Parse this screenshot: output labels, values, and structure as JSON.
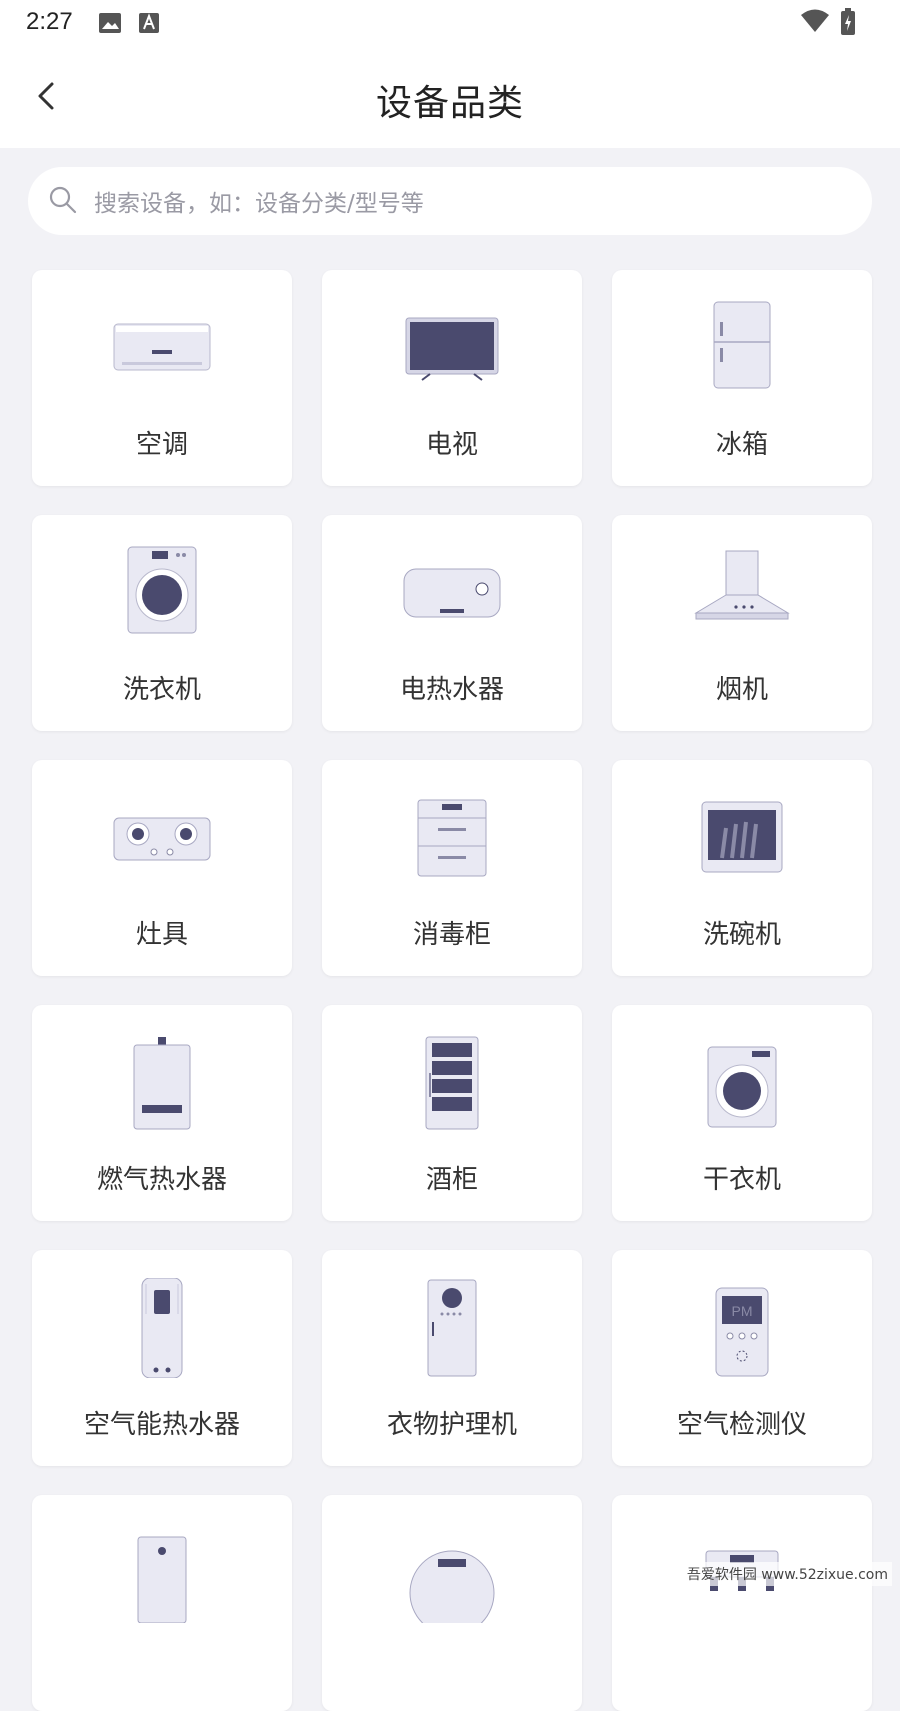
{
  "status_bar": {
    "time": "2:27"
  },
  "header": {
    "title": "设备品类"
  },
  "search": {
    "placeholder": "搜索设备，如：设备分类/型号等"
  },
  "categories": [
    {
      "label": "空调",
      "icon": "air-conditioner-icon"
    },
    {
      "label": "电视",
      "icon": "tv-icon"
    },
    {
      "label": "冰箱",
      "icon": "fridge-icon"
    },
    {
      "label": "洗衣机",
      "icon": "washing-machine-icon"
    },
    {
      "label": "电热水器",
      "icon": "electric-water-heater-icon"
    },
    {
      "label": "烟机",
      "icon": "range-hood-icon"
    },
    {
      "label": "灶具",
      "icon": "stove-icon"
    },
    {
      "label": "消毒柜",
      "icon": "disinfection-cabinet-icon"
    },
    {
      "label": "洗碗机",
      "icon": "dishwasher-icon"
    },
    {
      "label": "燃气热水器",
      "icon": "gas-water-heater-icon"
    },
    {
      "label": "酒柜",
      "icon": "wine-cabinet-icon"
    },
    {
      "label": "干衣机",
      "icon": "dryer-icon"
    },
    {
      "label": "空气能热水器",
      "icon": "air-energy-water-heater-icon"
    },
    {
      "label": "衣物护理机",
      "icon": "clothes-care-icon"
    },
    {
      "label": "空气检测仪",
      "icon": "air-monitor-icon"
    },
    {
      "label": "",
      "icon": "water-purifier-icon"
    },
    {
      "label": "",
      "icon": "robot-vacuum-icon"
    },
    {
      "label": "",
      "icon": "appliance-icon"
    }
  ],
  "watermark": {
    "text": "吾爱软件园 www.52zixue.com"
  },
  "colors": {
    "background": "#f2f2f6",
    "icon_dark": "#4a4a6e",
    "icon_light": "#e9e9f3"
  }
}
